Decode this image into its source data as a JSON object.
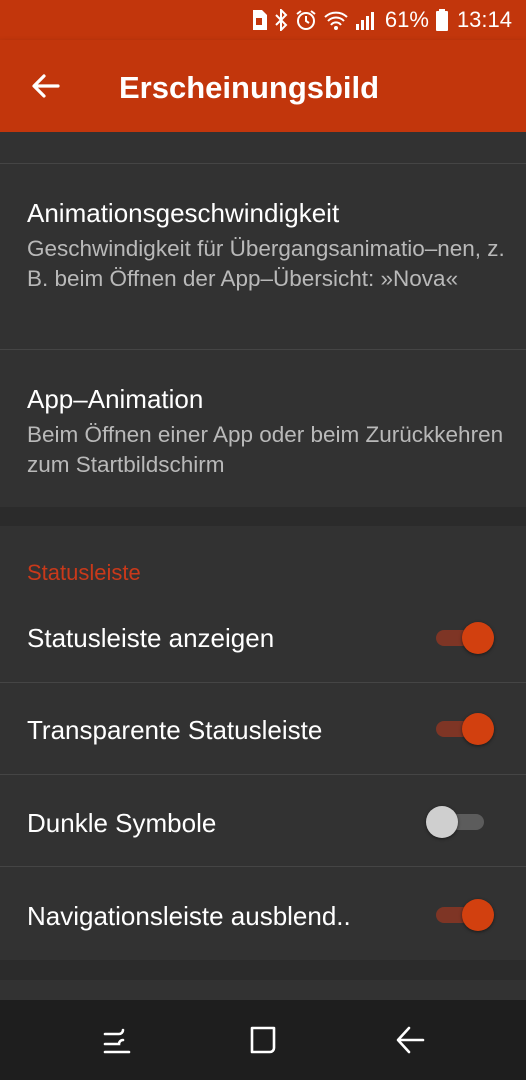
{
  "status_bar": {
    "battery_percent": "61%",
    "time": "13:14",
    "icons": [
      "sim-icon",
      "bluetooth-icon",
      "alarm-icon",
      "wifi-icon",
      "signal-icon",
      "battery-icon"
    ]
  },
  "app_bar": {
    "title": "Erscheinungsbild",
    "back_icon": "arrow-left-icon"
  },
  "settings": {
    "animation_speed": {
      "title": "Animationsgeschwindigkeit",
      "subtitle": "Geschwindigkeit für Übergangsanimatio–nen, z. B. beim Öffnen der App–Übersicht: »Nova«"
    },
    "app_animation": {
      "title": "App–Animation",
      "subtitle": "Beim Öffnen einer App oder beim Zurückkehren zum Startbildschirm"
    }
  },
  "statusleiste_section": {
    "header": "Statusleiste",
    "items": [
      {
        "label": "Statusleiste anzeigen",
        "enabled": true
      },
      {
        "label": "Transparente Statusleiste",
        "enabled": true
      },
      {
        "label": "Dunkle Symbole",
        "enabled": false
      },
      {
        "label": "Navigationsleiste ausblend..",
        "enabled": true
      }
    ]
  },
  "colors": {
    "accent": "#c2360c",
    "background": "#2b2b2b",
    "card": "#323232"
  },
  "nav_bar": {
    "icons": [
      "recents-icon",
      "home-icon",
      "back-icon"
    ]
  }
}
